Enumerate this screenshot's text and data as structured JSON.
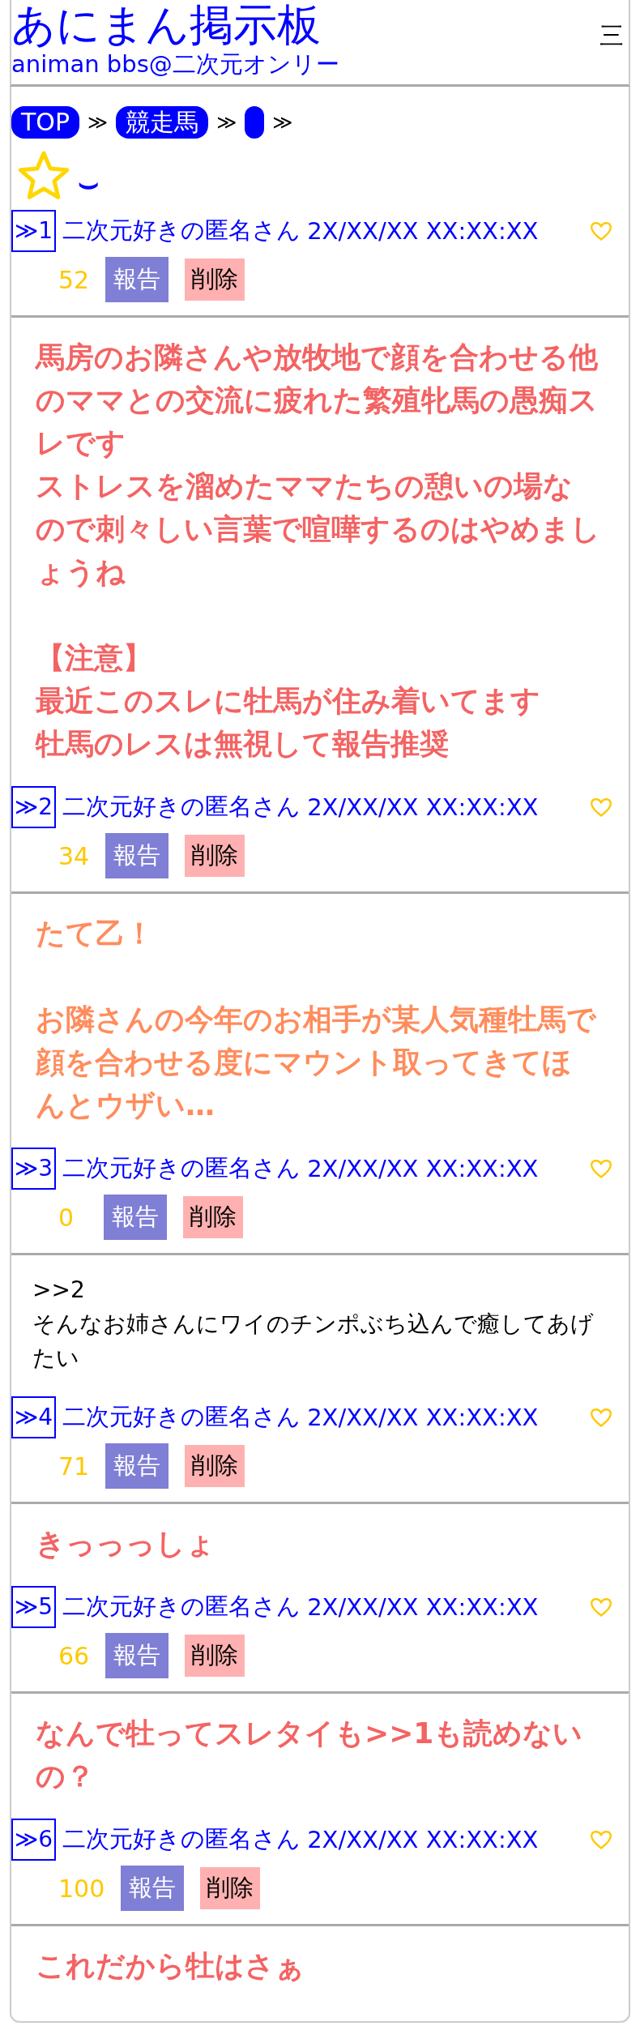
{
  "header": {
    "title": "あにまん掲示板",
    "subtitle": "animan bbs@二次元オンリー",
    "menu": "三"
  },
  "breadcrumb": [
    {
      "label": "TOP",
      "separator": "≫"
    },
    {
      "label": "競走馬",
      "separator": "≫"
    },
    {
      "separator": "≫"
    }
  ],
  "thread_title": "⌣",
  "posts": [
    {
      "number": "≫1",
      "name": "二次元好きの匿名さん",
      "date": "2X/XX/XX XX:XX:XX",
      "likes": "52",
      "report": "報告",
      "delete": "削除"
    },
    {
      "paragraphs": [
        [
          "馬房のお隣さんや放牧地で顔を合わせる他のママとの交流に疲れた繁殖牝馬の愚痴スレです",
          "ストレスを溜めたママたちの憩いの場なので刺々しい言葉で喧嘩するのはやめましょうね"
        ],
        [
          "【注意】",
          "最近このスレに牡馬が住み着いてます",
          "牡馬のレスは無視して報告推奨"
        ]
      ],
      "color": "#f46363",
      "bold": true,
      "number": "≫2",
      "name": "二次元好きの匿名さん",
      "date": "2X/XX/XX XX:XX:XX",
      "likes": "34",
      "report": "報告",
      "delete": "削除"
    },
    {
      "paragraphs": [
        [
          "たて乙！"
        ],
        [
          "お隣さんの今年のお相手が某人気種牡馬で顔を合わせる度にマウント取ってきてほんとウザい…"
        ]
      ],
      "color": "#ff8c5c",
      "bold": true,
      "number": "≫3",
      "name": "二次元好きの匿名さん",
      "date": "2X/XX/XX XX:XX:XX",
      "likes": "0",
      "report": "報告",
      "delete": "削除"
    },
    {
      "paragraphs": [
        [
          ">>2",
          "そんなお姉さんにワイのチンポぶち込んで癒してあげたい"
        ]
      ],
      "color": "#000000",
      "bold": false,
      "number": "≫4",
      "name": "二次元好きの匿名さん",
      "date": "2X/XX/XX XX:XX:XX",
      "likes": "71",
      "report": "報告",
      "delete": "削除"
    },
    {
      "paragraphs": [
        [
          "きっっっしょ"
        ]
      ],
      "color": "#f46363",
      "bold": true,
      "number": "≫5",
      "name": "二次元好きの匿名さん",
      "date": "2X/XX/XX XX:XX:XX",
      "likes": "66",
      "report": "報告",
      "delete": "削除"
    },
    {
      "paragraphs": [
        [
          "なんで牡ってスレタイも>>1も読めないの？"
        ]
      ],
      "color": "#f46363",
      "bold": true,
      "number": "≫6",
      "name": "二次元好きの匿名さん",
      "date": "2X/XX/XX XX:XX:XX",
      "likes": "100",
      "report": "報告",
      "delete": "削除"
    },
    {
      "paragraphs": [
        [
          "これだから牡はさぁ"
        ]
      ],
      "color": "#f46363",
      "bold": true
    }
  ]
}
